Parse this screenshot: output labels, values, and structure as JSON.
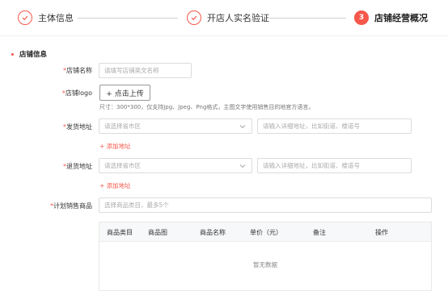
{
  "steps": [
    {
      "label": "主体信息",
      "status": "done",
      "icon": "check-circle-icon"
    },
    {
      "label": "开店人实名验证",
      "status": "done",
      "icon": "check-circle-icon"
    },
    {
      "label": "店铺经营概况",
      "status": "active",
      "number": "3"
    }
  ],
  "section": {
    "title": "店铺信息"
  },
  "form": {
    "required_mark": "*",
    "shop_name": {
      "label": "店铺名称",
      "placeholder": "请填写店铺英文名称"
    },
    "shop_logo": {
      "label": "店铺logo",
      "upload_label": "+ 点击上传",
      "hint": "尺寸：300*300，仅支持Jpg、Jpeg、Png格式，主图文字使用销售目的地官方语言。"
    },
    "ship_address": {
      "label": "发货地址",
      "region_placeholder": "请选择省市区",
      "detail_placeholder": "请输入详细地址，比如街道、楼道号",
      "add_label": "+ 添加地址"
    },
    "return_address": {
      "label": "退货地址",
      "region_placeholder": "请选择省市区",
      "detail_placeholder": "请输入详细地址，比如街道、楼道号",
      "add_label": "+ 添加地址"
    },
    "plan_goods": {
      "label": "计划销售商品",
      "placeholder": "选择商品类目，最多5个"
    }
  },
  "table": {
    "columns": [
      "商品类目",
      "商品图",
      "商品名称",
      "单价（元）",
      "备注",
      "操作"
    ],
    "empty_text": "暂无数据"
  },
  "colors": {
    "accent": "#f5574a",
    "border": "#dcdcdc"
  }
}
